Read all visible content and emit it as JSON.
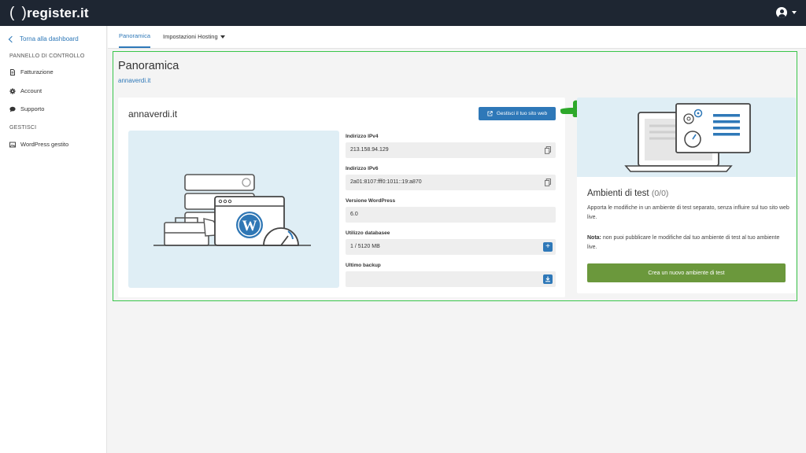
{
  "brand": {
    "logo_text": "register.it"
  },
  "sidebar": {
    "back_label": "Torna alla dashboard",
    "section_control": "PANNELLO DI CONTROLLO",
    "items": [
      {
        "label": "Fatturazione",
        "icon": "invoice-icon"
      },
      {
        "label": "Account",
        "icon": "gear-icon"
      },
      {
        "label": "Supporto",
        "icon": "chat-icon"
      }
    ],
    "section_manage": "GESTISCI",
    "manage_items": [
      {
        "label": "WordPress gestito",
        "icon": "image-icon"
      }
    ]
  },
  "tabs": [
    {
      "label": "Panoramica",
      "active": true
    },
    {
      "label": "Impostazioni Hosting",
      "active": false
    }
  ],
  "page": {
    "title": "Panoramica",
    "domain_link": "annaverdi.it"
  },
  "site_card": {
    "domain": "annaverdi.it",
    "manage_button": "Gestisci il tuo sito web",
    "fields": [
      {
        "label": "Indirizzo IPv4",
        "value": "213.158.94.129",
        "action": "copy-icon"
      },
      {
        "label": "Indirizzo IPv6",
        "value": "2a01:8107:fff0:1011::19:a870",
        "action": "copy-icon"
      },
      {
        "label": "Versione WordPress",
        "value": "6.0",
        "action": ""
      },
      {
        "label": "Utilizzo databasee",
        "value": "1 / 5120 MB",
        "action": "plus-icon"
      },
      {
        "label": "Ultimo backup",
        "value": "",
        "action": "download-icon"
      }
    ]
  },
  "test_card": {
    "title": "Ambienti di test",
    "count": "(0/0)",
    "description": "Apporta le modifiche in un ambiente di test separato, senza influire sul tuo sito web live.",
    "note_bold": "Nota:",
    "note_text": " non puoi pubblicare le modifiche dal tuo ambiente di test al tuo ambiente live.",
    "create_button": "Crea un nuovo ambiente di test"
  },
  "colors": {
    "topbar": "#1e2632",
    "accent": "#2e78b8",
    "create_button": "#6b983c",
    "highlight_frame": "#39c54a",
    "illustration_bg": "#dfeef5"
  }
}
